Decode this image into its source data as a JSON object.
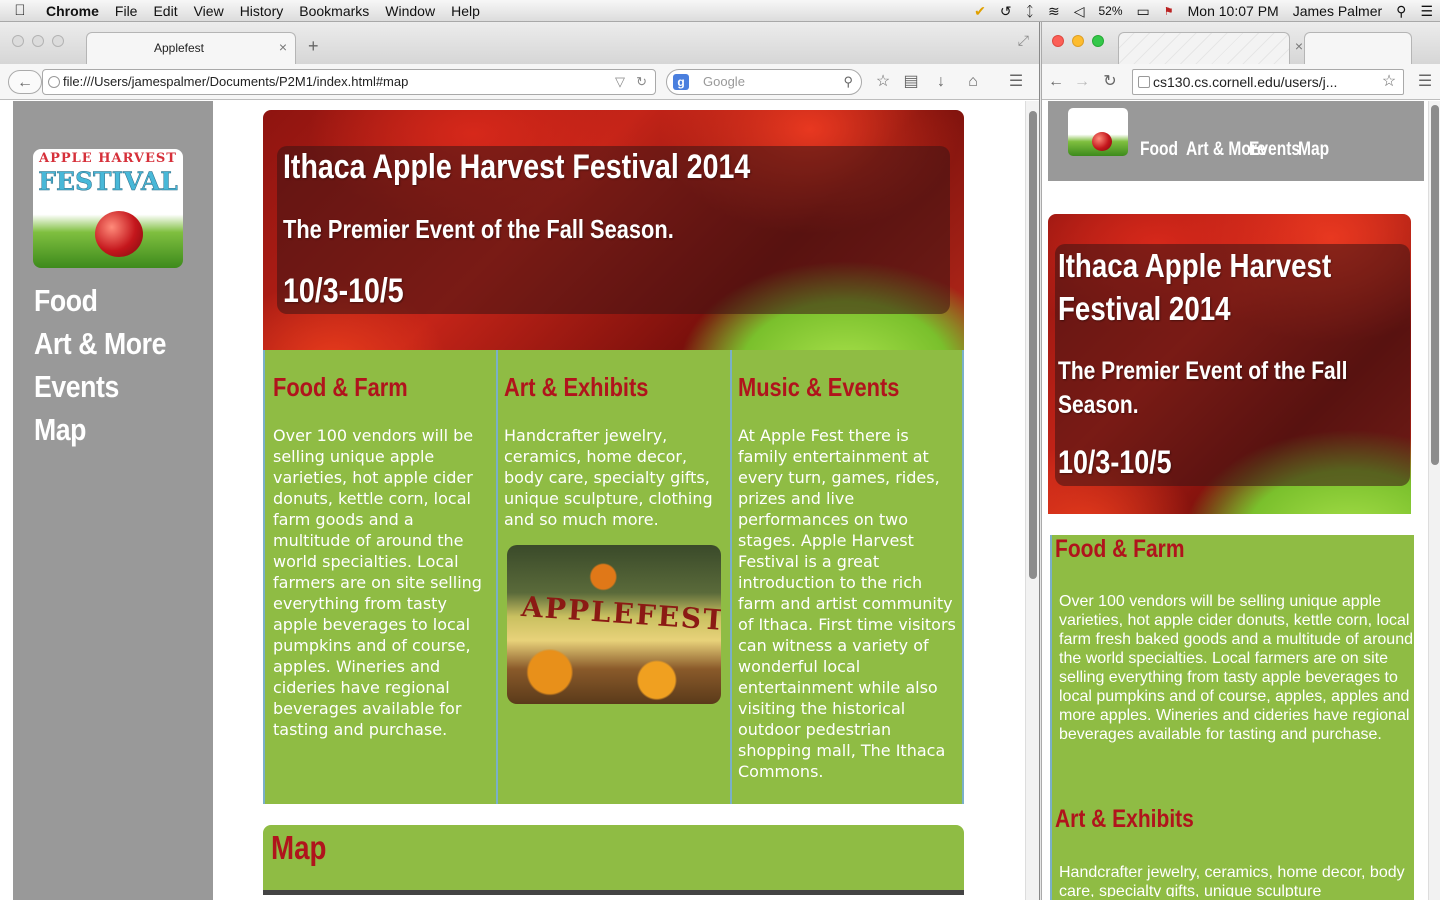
{
  "menubar": {
    "app_name": "Chrome",
    "menus": [
      "File",
      "Edit",
      "View",
      "History",
      "Bookmarks",
      "Window",
      "Help"
    ],
    "battery": "52%",
    "clock": "Mon 10:07 PM",
    "user": "James Palmer"
  },
  "left_window": {
    "tab_title": "Applefest",
    "url": "file:///Users/jamespalmer/Documents/P2M1/index.html#map",
    "search_placeholder": "Google",
    "page": {
      "logo_line1": "APPLE HARVEST",
      "logo_line2": "FESTIVAL",
      "nav": [
        "Food",
        "Art & More",
        "Events",
        "Map"
      ],
      "hero_title": "Ithaca Apple Harvest Festival 2014",
      "hero_subtitle": "The Premier Event of the Fall Season.",
      "hero_dates": "10/3-10/5",
      "columns": [
        {
          "heading": "Food & Farm",
          "body": "Over 100 vendors will be selling unique apple varieties, hot apple cider donuts, kettle corn, local farm goods and a multitude of around the world specialties. Local farmers are on site selling everything from tasty apple beverages to local pumpkins and of course, apples. Wineries and cideries have regional beverages available for tasting and purchase."
        },
        {
          "heading": "Art & Exhibits",
          "body": "Handcrafter jewelry, ceramics, home decor, body care, specialty gifts, unique sculpture, clothing and so much more.",
          "photo_sign": "APPLEFEST"
        },
        {
          "heading": "Music & Events",
          "body": "At Apple Fest there is family entertainment at every turn, games, rides, prizes and live performances on two stages. Apple Harvest Festival is a great introduction to the rich farm and artist community of Ithaca. First time visitors can witness a variety of wonderful local entertainment while also visiting the historical outdoor pedestrian shopping mall, The Ithaca Commons."
        }
      ],
      "map_heading": "Map"
    }
  },
  "right_window": {
    "url": "cs130.cs.cornell.edu/users/j...",
    "page": {
      "nav": [
        "Food",
        "Art & More",
        "Events",
        "Map"
      ],
      "hero_title_l1": "Ithaca Apple Harvest",
      "hero_title_l2": "Festival 2014",
      "hero_subtitle_l1": "The Premier Event of the Fall",
      "hero_subtitle_l2": "Season.",
      "hero_dates": "10/3-10/5",
      "food_heading": "Food & Farm",
      "food_body": "Over 100 vendors will be selling unique apple varieties, hot apple cider donuts, kettle corn, local farm fresh baked goods and a multitude of around the world specialties. Local farmers are on site selling everything from tasty apple beverages to local pumpkins and of course, apples, apples and more apples. Wineries and cideries have regional beverages available for tasting and purchase.",
      "art_heading": "Art & Exhibits",
      "art_body": "Handcrafter jewelry, ceramics, home decor, body care, specialty gifts, unique sculpture"
    }
  },
  "colors": {
    "sidebar_gray": "#999999",
    "content_green": "#8fbc44",
    "heading_red": "#b0141c",
    "column_divider": "#7ab0c8"
  }
}
